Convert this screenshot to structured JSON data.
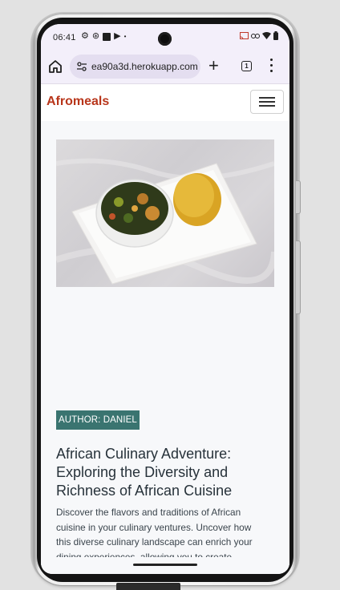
{
  "status_bar": {
    "time": "06:41",
    "left_icons": [
      "settings-icon",
      "sync-icon",
      "stop-icon",
      "play-icon",
      "dot-icon"
    ],
    "right_icons": [
      "cast-icon",
      "link-icon",
      "wifi-icon",
      "battery-icon"
    ]
  },
  "browser": {
    "url": "ea90a3d.herokuapp.com",
    "tab_count": "1"
  },
  "site": {
    "brand": "Afromeals",
    "brand_color": "#b8361b"
  },
  "post": {
    "image_description_icon": "food-photo",
    "author_label": "AUTHOR: DANIEL",
    "title": "African Culinary Adventure: Exploring the Diversity and Richness of African Cuisine",
    "excerpt": "Discover the flavors and traditions of African cuisine in your culinary ventures. Uncover how this diverse culinary landscape can enrich your dining experiences, allowing you to create"
  },
  "colors": {
    "badge": "#3a7470",
    "title": "#27323a",
    "chrome": "#f3effa"
  }
}
